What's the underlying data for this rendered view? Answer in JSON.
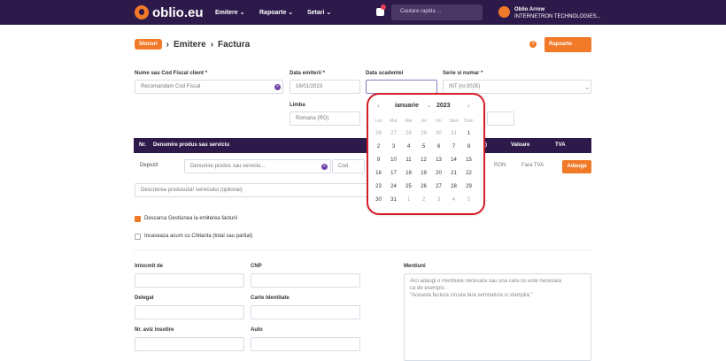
{
  "topbar": {
    "brand": "oblio.eu",
    "menu": [
      "Emitere ⌄",
      "Rapoarte ⌄",
      "Setari ⌄"
    ],
    "search": "Cautare rapida ...",
    "user_name": "Oblio Arrow",
    "company": "INTERNETRON TECHNOLOGIES..."
  },
  "breadcrumb": {
    "stoc": "Stocuri",
    "part1": "Emitere",
    "part2": "Factura",
    "sep": "›"
  },
  "report": "Rapoarte",
  "help": "?",
  "form": {
    "client_label": "Nume sau Cod Fiscal client *",
    "client_placeholder": "Recomandam Cod Fiscal",
    "date_label": "Data emiterii *",
    "date_value": "16/01/2023",
    "due_label": "Data scadentei",
    "due_value": "",
    "series_label": "Serie si numar *",
    "series_value": "INT (nr.0025)",
    "lang_label": "Limba",
    "lang_value": "Romana (RO)"
  },
  "table_header": {
    "nr": "Nr.",
    "product": "Denumire produs sau serviciu",
    "m": "(M)",
    "value": "Valoare",
    "vat": "TVA"
  },
  "line": {
    "depot": "Depozit",
    "product_placeholder": "Denumire produs sau serviciu...",
    "code_placeholder": "Cod",
    "currency": "RON",
    "vat": "Fara TVA",
    "add_button": "Adauga",
    "description_placeholder": "Descrierea produsului/ serviciului (optional)"
  },
  "checks": {
    "discharge": "Descarca Gestiunea la emiterea facturii",
    "collect": "Incaseaza acum cu Chitanta (total sau partial)"
  },
  "bottom": {
    "prepared": "Intocmit de",
    "cnp": "CNP",
    "delegate": "Delegat",
    "id_card": "Carte Identitate",
    "notice": "Nr. aviz insotire",
    "car": "Auto",
    "mentions": "Mentiuni",
    "mentions_text": "Aici adaugi o mentiune necesara sau una care nu este necesara\nca de exemplu :\n\"Aceasta factura circula fara semnatura si stampila.\""
  },
  "calendar": {
    "month": "ianuarie",
    "year": "2023",
    "weekdays": [
      "Lun",
      "Mar",
      "Mie",
      "Joi",
      "Vin",
      "Sâm",
      "Dum"
    ],
    "days": [
      [
        "26",
        "27",
        "28",
        "29",
        "30",
        "31",
        "1"
      ],
      [
        "2",
        "3",
        "4",
        "5",
        "6",
        "7",
        "8"
      ],
      [
        "9",
        "10",
        "11",
        "12",
        "13",
        "14",
        "15"
      ],
      [
        "16",
        "17",
        "18",
        "19",
        "20",
        "21",
        "22"
      ],
      [
        "23",
        "24",
        "25",
        "26",
        "27",
        "28",
        "29"
      ],
      [
        "30",
        "31",
        "1",
        "2",
        "3",
        "4",
        "5"
      ]
    ]
  },
  "icons": {
    "logo": "oblio-logo",
    "bell": "bell-icon",
    "clear": "clear-icon",
    "help": "help-icon"
  }
}
